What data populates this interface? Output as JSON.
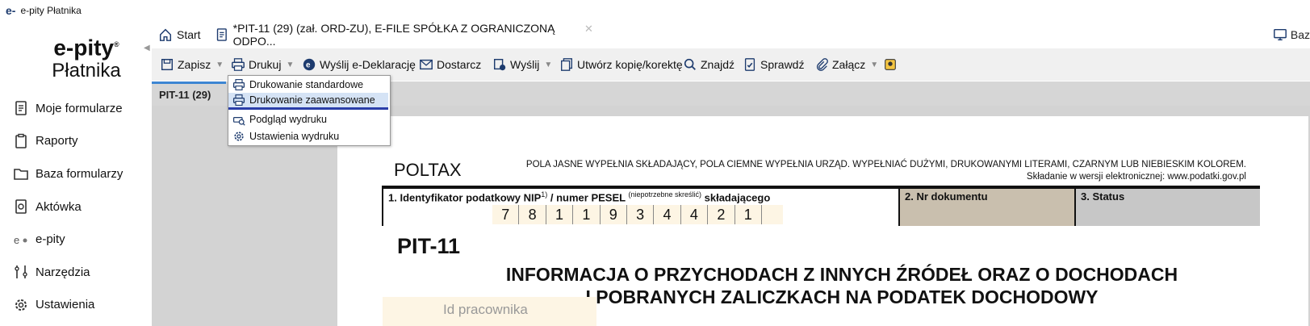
{
  "window": {
    "title": "e-pity Płatnika",
    "logo": "e-"
  },
  "sidebar": {
    "brand_line1": "e-pity",
    "brand_reg": "®",
    "brand_line2": "Płatnika",
    "items": [
      {
        "label": "Moje formularze",
        "icon": "forms-icon"
      },
      {
        "label": "Raporty",
        "icon": "clipboard-icon"
      },
      {
        "label": "Baza formularzy",
        "icon": "folder-icon"
      },
      {
        "label": "Aktówka",
        "icon": "briefcase-icon"
      },
      {
        "label": "e-pity",
        "icon": "epity-icon"
      },
      {
        "label": "Narzędzia",
        "icon": "tools-icon"
      },
      {
        "label": "Ustawienia",
        "icon": "gear-icon"
      }
    ]
  },
  "tabs": {
    "start": "Start",
    "doc": "*PIT-11 (29) (zał. ORD-ZU), E-FILE SPÓŁKA Z OGRANICZONĄ ODPO...",
    "close": "✕",
    "right": "Baz"
  },
  "toolbar": {
    "save": "Zapisz",
    "print": "Drukuj",
    "send_edecl": "Wyślij e-Deklarację",
    "deliver": "Dostarcz",
    "send": "Wyślij",
    "copy": "Utwórz kopię/korektę",
    "find": "Znajdź",
    "check": "Sprawdź",
    "attach": "Załącz"
  },
  "print_menu": {
    "items": [
      "Drukowanie standardowe",
      "Drukowanie zaawansowane",
      "Podgląd wydruku",
      "Ustawienia wydruku"
    ]
  },
  "doc_tab": "PIT-11 (29)",
  "form": {
    "poltax": "POLTAX",
    "notice_line1": "POLA JASNE WYPEŁNIA SKŁADAJĄCY, POLA CIEMNE WYPEŁNIA URZĄD. WYPEŁNIAĆ DUŻYMI, DRUKOWANYMI LITERAMI, CZARNYM LUB NIEBIESKIM KOLOREM.",
    "notice_line2": "Składanie w wersji elektronicznej: www.podatki.gov.pl",
    "field1_a": "1. Identyfikator podatkowy NIP",
    "field1_sup": "1)",
    "field1_b": " / numer PESEL ",
    "field1_note": "(niepotrzebne skreślić)",
    "field1_c": " składającego",
    "field2": "2. Nr dokumentu",
    "field3": "3. Status",
    "digits": [
      "7",
      "8",
      "1",
      "1",
      "9",
      "3",
      "4",
      "4",
      "2",
      "1"
    ],
    "pit": "PIT-11",
    "heading_line1": "INFORMACJA O PRZYCHODACH Z INNYCH ŹRÓDEŁ ORAZ O DOCHODACH",
    "heading_line2": "I POBRANYCH ZALICZKACH NA PODATEK DOCHODOWY",
    "id_placeholder": "Id pracownika"
  }
}
